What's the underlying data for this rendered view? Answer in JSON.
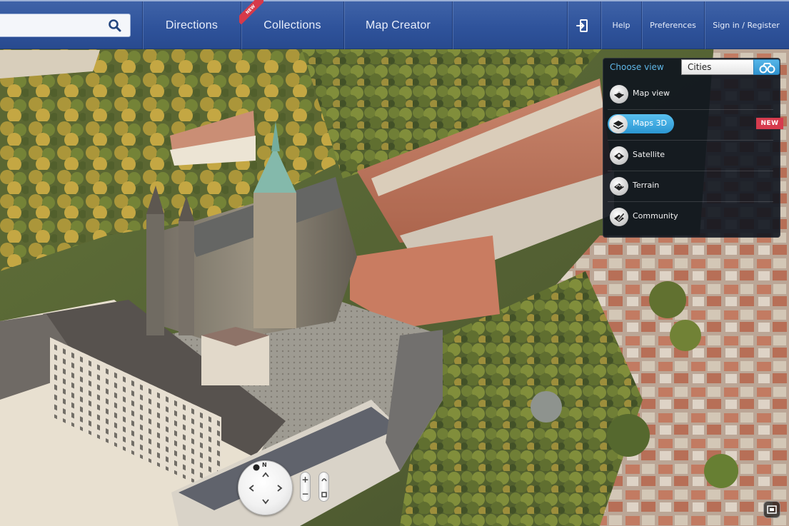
{
  "search": {
    "placeholder": "",
    "value": "",
    "icon": "search-icon"
  },
  "nav": {
    "items": [
      {
        "label": "Directions"
      },
      {
        "label": "Collections",
        "ribbon": "NEW"
      },
      {
        "label": "Map Creator"
      }
    ],
    "right": {
      "login_icon": "sign-in-icon",
      "help": "Help",
      "preferences": "Preferences",
      "sign_in": "Sign in / Register"
    }
  },
  "view_panel": {
    "title": "Choose view",
    "city_select": "Cities",
    "binoculars_icon": "binoculars-icon",
    "options": [
      {
        "label": "Map view",
        "icon": "map-view-icon",
        "selected": false
      },
      {
        "label": "Maps 3D",
        "icon": "maps-3d-icon",
        "selected": true,
        "badge": "NEW"
      },
      {
        "label": "Satellite",
        "icon": "satellite-icon",
        "selected": false
      },
      {
        "label": "Terrain",
        "icon": "terrain-icon",
        "selected": false
      },
      {
        "label": "Community",
        "icon": "community-icon",
        "selected": false
      }
    ]
  },
  "controls": {
    "compass_north": "N",
    "zoom_in": "+",
    "zoom_out": "−"
  },
  "colors": {
    "topbar": "#2f539b",
    "accent": "#4aaee3",
    "badge": "#d63b4d",
    "panel": "#0e141e"
  }
}
